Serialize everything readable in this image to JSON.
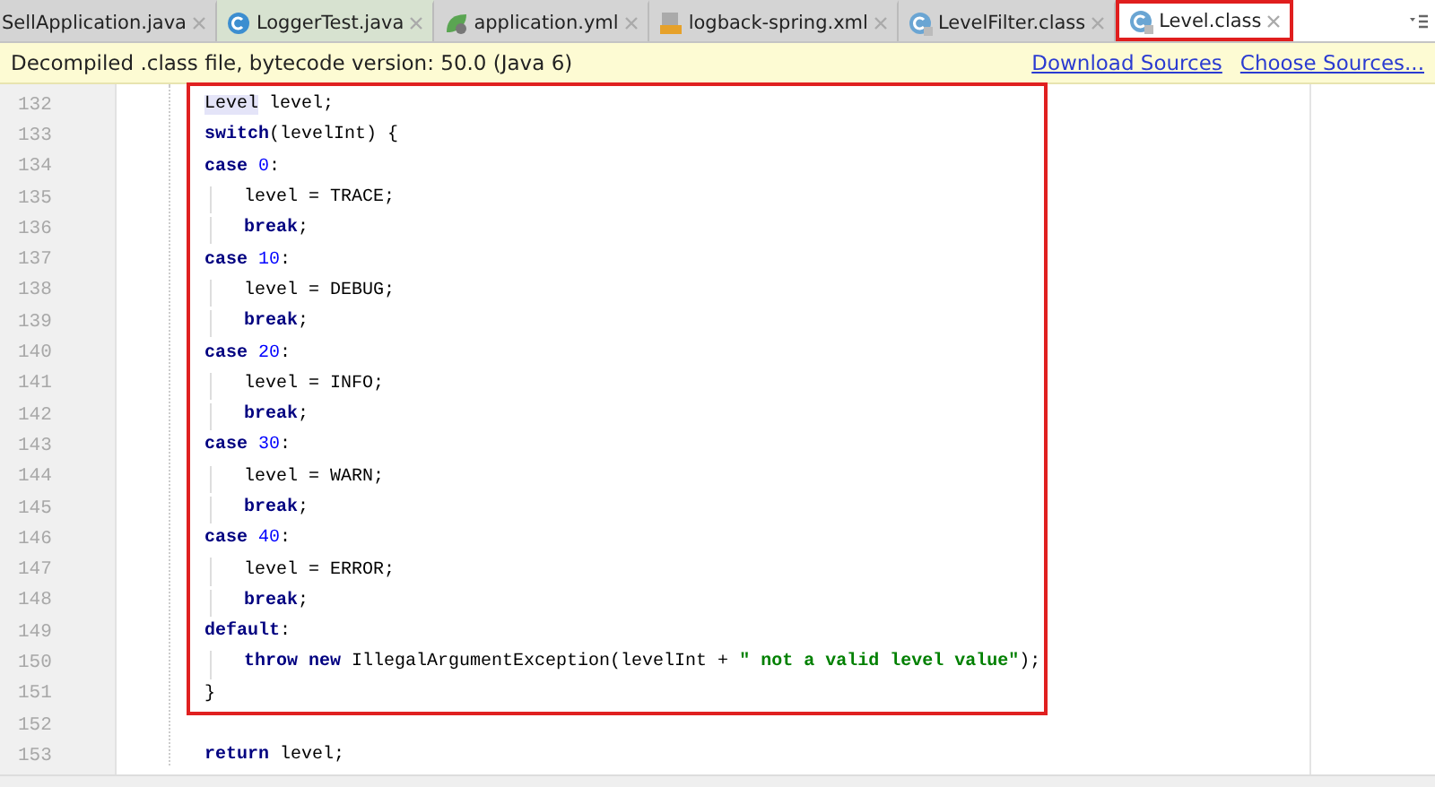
{
  "tabs": [
    {
      "label": "SellApplication.java",
      "kind": "plain",
      "selected": false,
      "tint": false,
      "boxed": false
    },
    {
      "label": "LoggerTest.java",
      "kind": "source",
      "selected": false,
      "tint": true,
      "boxed": false
    },
    {
      "label": "application.yml",
      "kind": "config",
      "selected": false,
      "tint": false,
      "boxed": false
    },
    {
      "label": "logback-spring.xml",
      "kind": "markup",
      "selected": false,
      "tint": false,
      "boxed": false
    },
    {
      "label": "LevelFilter.class",
      "kind": "compiled",
      "selected": false,
      "tint": false,
      "boxed": false
    },
    {
      "label": "Level.class",
      "kind": "compiled",
      "selected": true,
      "tint": false,
      "boxed": true
    }
  ],
  "banner": {
    "message": "Decompiled .class file, bytecode version: 50.0 (Java 6)",
    "links": [
      "Download Sources",
      "Choose Sources..."
    ]
  },
  "code": [
    {
      "boxed": true,
      "lines": [
        {
          "number": "132",
          "kind": "outer",
          "tokens": [
            {
              "kind": "highlight",
              "text": "Level"
            },
            {
              "kind": "plain",
              "text": " level;"
            }
          ]
        },
        {
          "number": "133",
          "kind": "outer",
          "tokens": [
            {
              "kind": "keyword",
              "text": "switch"
            },
            {
              "kind": "plain",
              "text": "(levelInt) {"
            }
          ]
        },
        {
          "number": "134",
          "kind": "outer",
          "tokens": [
            {
              "kind": "keyword",
              "text": "case"
            },
            {
              "kind": "number",
              "text": "0"
            },
            {
              "kind": "plain",
              "text": ":"
            }
          ]
        },
        {
          "number": "135",
          "kind": "inner",
          "tokens": [
            {
              "kind": "plain",
              "text": "level = TRACE;"
            }
          ]
        },
        {
          "number": "136",
          "kind": "inner",
          "tokens": [
            {
              "kind": "keyword",
              "text": "break"
            },
            {
              "kind": "plain",
              "text": ";"
            }
          ]
        },
        {
          "number": "137",
          "kind": "outer",
          "tokens": [
            {
              "kind": "keyword",
              "text": "case"
            },
            {
              "kind": "number",
              "text": "10"
            },
            {
              "kind": "plain",
              "text": ":"
            }
          ]
        },
        {
          "number": "138",
          "kind": "inner",
          "tokens": [
            {
              "kind": "plain",
              "text": "level = DEBUG;"
            }
          ]
        },
        {
          "number": "139",
          "kind": "inner",
          "tokens": [
            {
              "kind": "keyword",
              "text": "break"
            },
            {
              "kind": "plain",
              "text": ";"
            }
          ]
        },
        {
          "number": "140",
          "kind": "outer",
          "tokens": [
            {
              "kind": "keyword",
              "text": "case"
            },
            {
              "kind": "number",
              "text": "20"
            },
            {
              "kind": "plain",
              "text": ":"
            }
          ]
        },
        {
          "number": "141",
          "kind": "inner",
          "tokens": [
            {
              "kind": "plain",
              "text": "level = INFO;"
            }
          ]
        },
        {
          "number": "142",
          "kind": "inner",
          "tokens": [
            {
              "kind": "keyword",
              "text": "break"
            },
            {
              "kind": "plain",
              "text": ";"
            }
          ]
        },
        {
          "number": "143",
          "kind": "outer",
          "tokens": [
            {
              "kind": "keyword",
              "text": "case"
            },
            {
              "kind": "number",
              "text": "30"
            },
            {
              "kind": "plain",
              "text": ":"
            }
          ]
        },
        {
          "number": "144",
          "kind": "inner",
          "tokens": [
            {
              "kind": "plain",
              "text": "level = WARN;"
            }
          ]
        },
        {
          "number": "145",
          "kind": "inner",
          "tokens": [
            {
              "kind": "keyword",
              "text": "break"
            },
            {
              "kind": "plain",
              "text": ";"
            }
          ]
        },
        {
          "number": "146",
          "kind": "outer",
          "tokens": [
            {
              "kind": "keyword",
              "text": "case"
            },
            {
              "kind": "number",
              "text": "40"
            },
            {
              "kind": "plain",
              "text": ":"
            }
          ]
        },
        {
          "number": "147",
          "kind": "inner",
          "tokens": [
            {
              "kind": "plain",
              "text": "level = ERROR;"
            }
          ]
        },
        {
          "number": "148",
          "kind": "inner",
          "tokens": [
            {
              "kind": "keyword",
              "text": "break"
            },
            {
              "kind": "plain",
              "text": ";"
            }
          ]
        },
        {
          "number": "149",
          "kind": "outer",
          "tokens": [
            {
              "kind": "keyword",
              "text": "default"
            },
            {
              "kind": "plain",
              "text": ":"
            }
          ]
        },
        {
          "number": "150",
          "kind": "inner",
          "tokens": [
            {
              "kind": "keyword",
              "text": "throw new"
            },
            {
              "kind": "plain",
              "text": " IllegalArgumentException(levelInt + "
            },
            {
              "kind": "string",
              "text": "\" not a valid level value\""
            },
            {
              "kind": "plain",
              "text": ");"
            }
          ]
        },
        {
          "number": "151",
          "kind": "outer",
          "tokens": [
            {
              "kind": "plain",
              "text": "}"
            }
          ]
        }
      ]
    },
    {
      "boxed": false,
      "lines": [
        {
          "number": "152",
          "kind": "outer"
        },
        {
          "number": "153",
          "kind": "outer",
          "tokens": [
            {
              "kind": "keyword",
              "text": "return"
            },
            {
              "kind": "plain",
              "text": " level;"
            }
          ]
        }
      ]
    }
  ]
}
